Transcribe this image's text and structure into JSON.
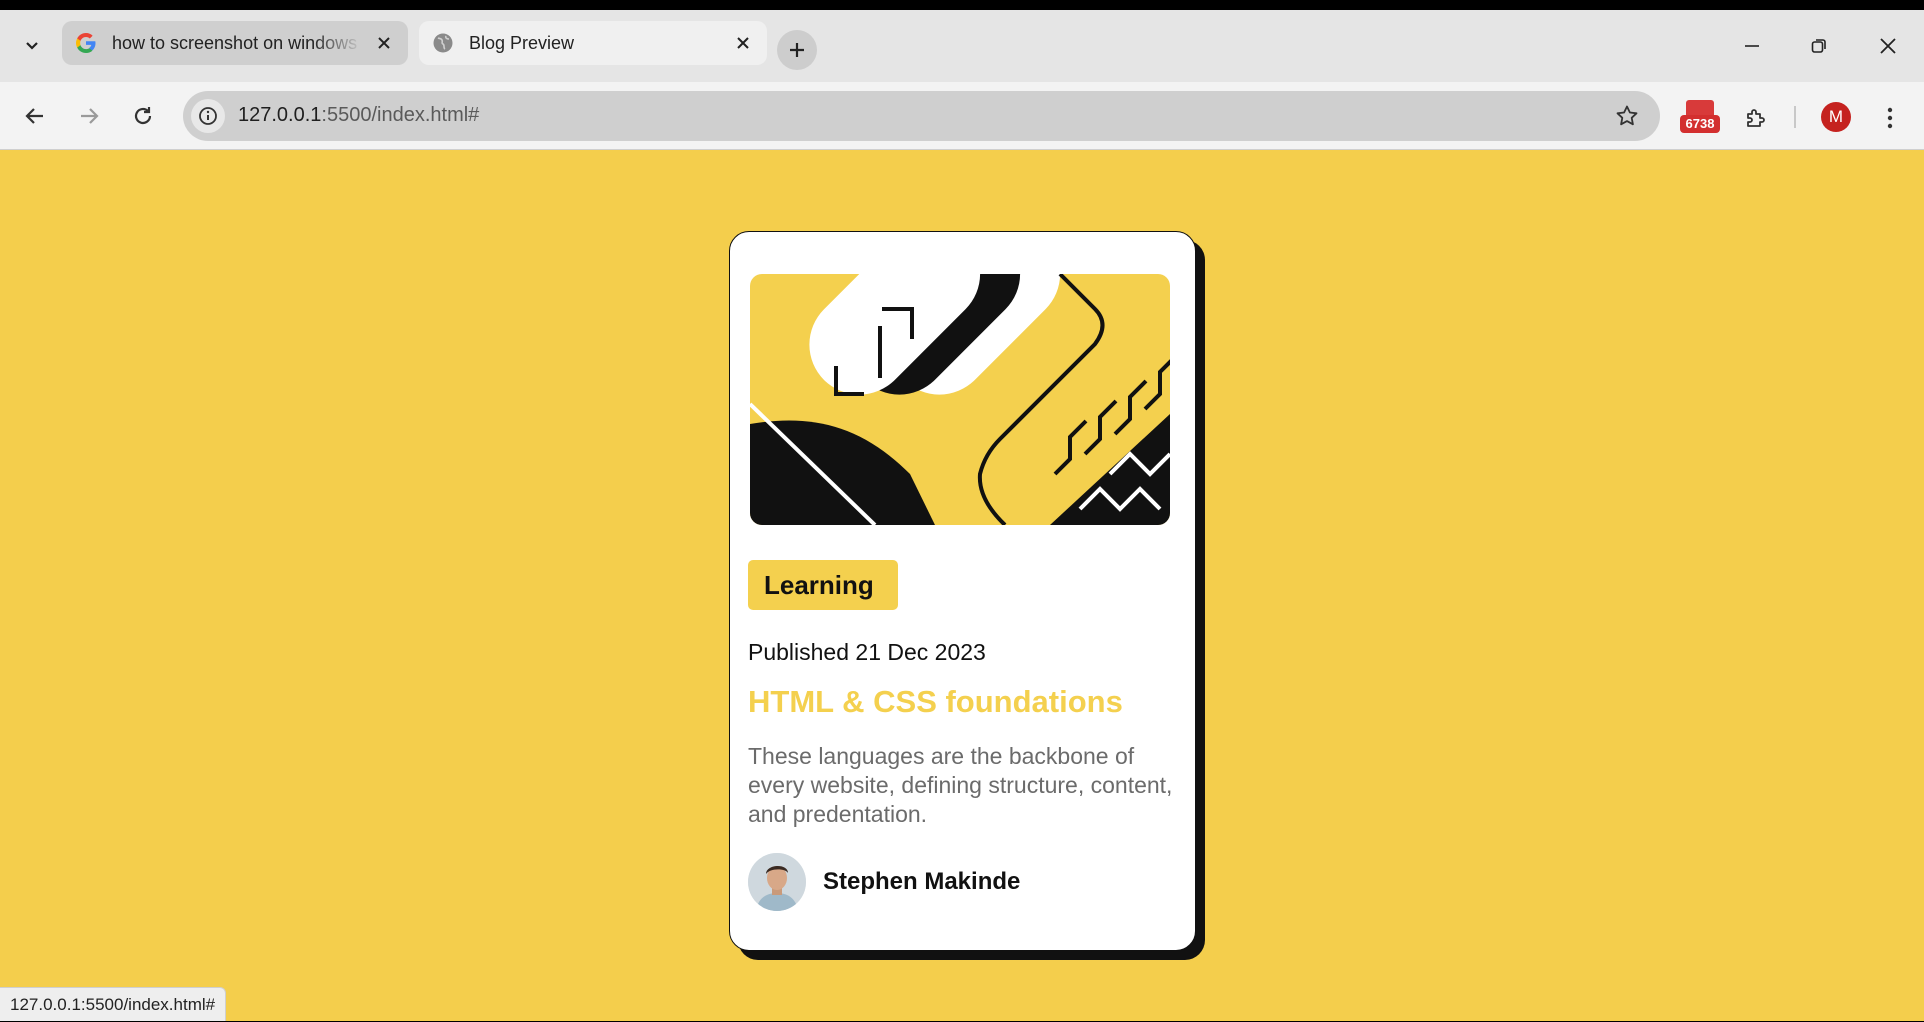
{
  "browser": {
    "tabs": [
      {
        "title": "how to screenshot on windows",
        "favicon": "google-icon",
        "active": false
      },
      {
        "title": "Blog Preview",
        "favicon": "globe-icon",
        "active": true
      }
    ],
    "address": {
      "host": "127.0.0.1",
      "rest": ":5500/index.html#"
    },
    "extension_badge": "6738",
    "profile_initial": "M"
  },
  "card": {
    "tag": "Learning",
    "published": "Published 21 Dec 2023",
    "title": "HTML & CSS foundations",
    "description": "These languages are the backbone of every website, defining structure, content, and predentation.",
    "author": "Stephen Makinde"
  },
  "status_url": "127.0.0.1:5500/index.html#",
  "colors": {
    "accent": "#f4d04e",
    "background": "#f4ce4c",
    "text": "#111111",
    "muted": "#6b6b6b"
  }
}
